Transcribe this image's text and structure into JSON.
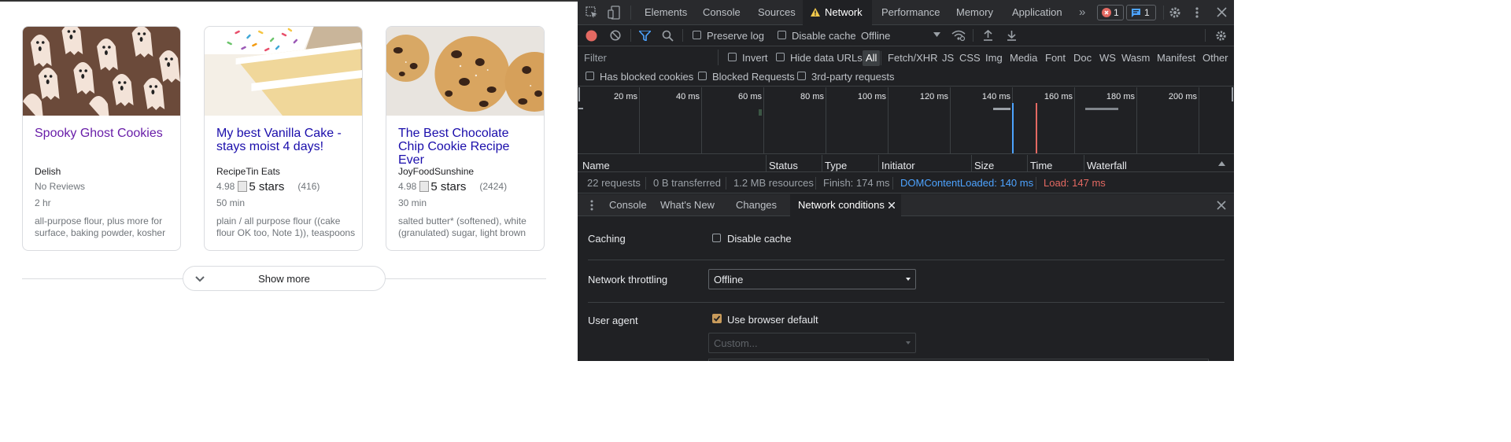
{
  "page": {
    "cards": [
      {
        "title": "Spooky Ghost Cookies",
        "source": "Delish",
        "rating_text": "No Reviews",
        "rating": null,
        "stars_alt": "",
        "review_count": "",
        "time": "2 hr",
        "ingredients": "all-purpose flour, plus more for surface, baking powder, kosher"
      },
      {
        "title": "My best Vanilla Cake - stays moist 4 days!",
        "source": "RecipeTin Eats",
        "rating": "4.98",
        "stars_alt": "5 stars",
        "review_count": "(416)",
        "time": "50 min",
        "ingredients": "plain / all purpose flour ((cake flour OK too, Note 1)), teaspoons"
      },
      {
        "title": "The Best Chocolate Chip Cookie Recipe Ever",
        "source": "JoyFoodSunshine",
        "rating": "4.98",
        "stars_alt": "5 stars",
        "review_count": "(2424)",
        "time": "30 min",
        "ingredients": "salted butter* (softened), white (granulated) sugar, light brown"
      }
    ],
    "show_more_label": "Show more"
  },
  "devtools": {
    "tabs": [
      "Elements",
      "Console",
      "Sources",
      "Network",
      "Performance",
      "Memory",
      "Application"
    ],
    "active_tab": "Network",
    "error_count": "1",
    "message_count": "1",
    "toolbar": {
      "preserve_log_label": "Preserve log",
      "preserve_log_checked": false,
      "disable_cache_label": "Disable cache",
      "disable_cache_checked": false,
      "throttling_value": "Offline"
    },
    "filter": {
      "placeholder": "Filter",
      "invert_label": "Invert",
      "hide_data_urls_label": "Hide data URLs",
      "types": [
        "All",
        "Fetch/XHR",
        "JS",
        "CSS",
        "Img",
        "Media",
        "Font",
        "Doc",
        "WS",
        "Wasm",
        "Manifest",
        "Other"
      ],
      "active_type": "All",
      "has_blocked_cookies_label": "Has blocked cookies",
      "blocked_requests_label": "Blocked Requests",
      "third_party_label": "3rd-party requests"
    },
    "timeline_ticks": [
      "20 ms",
      "40 ms",
      "60 ms",
      "80 ms",
      "100 ms",
      "120 ms",
      "140 ms",
      "160 ms",
      "180 ms",
      "200 ms"
    ],
    "columns": [
      "Name",
      "Status",
      "Type",
      "Initiator",
      "Size",
      "Time",
      "Waterfall"
    ],
    "summary": {
      "requests": "22 requests",
      "transferred": "0 B transferred",
      "resources": "1.2 MB resources",
      "finish": "Finish: 174 ms",
      "dcl": "DOMContentLoaded: 140 ms",
      "load": "Load: 147 ms",
      "dcl_color": "#4da3ff",
      "load_color": "#e46962"
    },
    "drawer": {
      "tabs": [
        "Console",
        "What's New",
        "Changes",
        "Network conditions"
      ],
      "active_tab": "Network conditions"
    },
    "network_conditions": {
      "caching_label": "Caching",
      "disable_cache_label": "Disable cache",
      "disable_cache_checked": false,
      "throttling_label": "Network throttling",
      "throttling_value": "Offline",
      "user_agent_label": "User agent",
      "use_browser_default_label": "Use browser default",
      "use_browser_default_checked": true,
      "custom_placeholder": "Custom..."
    }
  }
}
